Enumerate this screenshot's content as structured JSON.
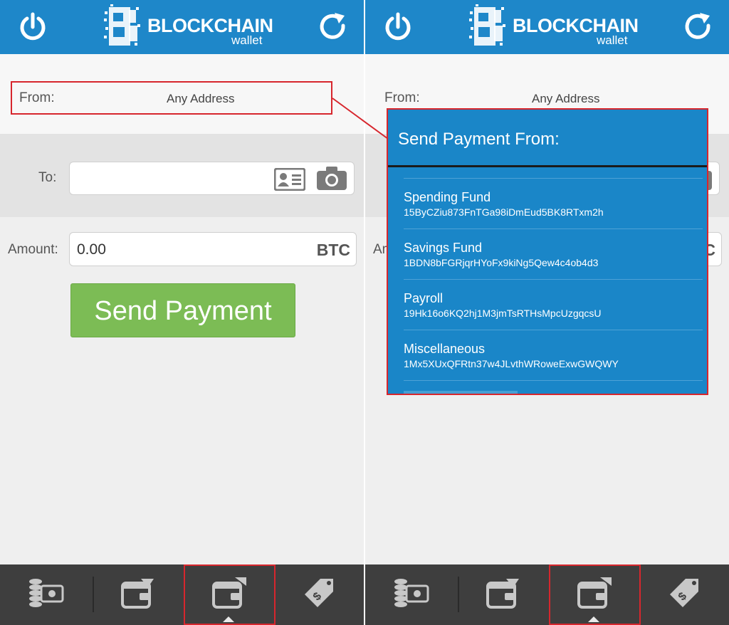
{
  "app": {
    "logo_text": "BLOCKCHAIN",
    "logo_subtext": "wallet"
  },
  "form": {
    "from_label": "From:",
    "from_value": "Any Address",
    "to_label": "To:",
    "to_value": "",
    "amount_label": "Amount:",
    "amount_value": "0.00",
    "amount_unit": "BTC",
    "send_button": "Send Payment"
  },
  "dialog": {
    "title": "Send Payment From:",
    "items": [
      {
        "name": "Spending Fund",
        "address": "15ByCZiu873FnTGa98iDmEud5BK8RTxm2h"
      },
      {
        "name": "Savings Fund",
        "address": "1BDN8bFGRjqrHYoFx9kiNg5Qew4c4ob4d3"
      },
      {
        "name": "Payroll",
        "address": "19Hk16o6KQ2hj1M3jmTsRTHsMpcUzgqcsU"
      },
      {
        "name": "Miscellaneous",
        "address": "1Mx5XUxQFRtn37w4JLvthWRoweExwGWQWY"
      }
    ]
  },
  "tabs": [
    {
      "name": "balance"
    },
    {
      "name": "receive"
    },
    {
      "name": "send",
      "active": true
    },
    {
      "name": "merchant"
    }
  ],
  "colors": {
    "header": "#1e87c9",
    "send_button": "#7cbc55",
    "dialog": "#1a86c8",
    "highlight": "#d7262d",
    "tabbar": "#3e3e3e"
  }
}
